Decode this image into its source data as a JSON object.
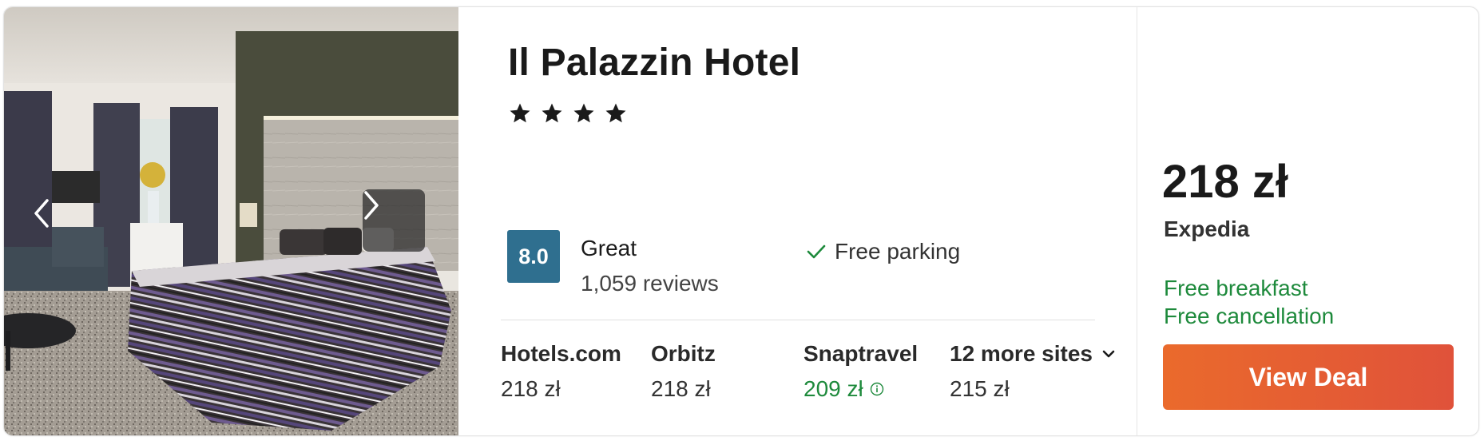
{
  "hotel": {
    "name": "Il Palazzin Hotel",
    "stars": 4
  },
  "gallery": {
    "prev_icon": "chevron-left-icon",
    "next_icon": "chevron-right-icon"
  },
  "rating": {
    "score": "8.0",
    "label": "Great",
    "reviews": "1,059 reviews",
    "badge_color": "#2f6f8f"
  },
  "amenities": [
    {
      "icon": "check-icon",
      "label": "Free parking"
    }
  ],
  "other_sites": [
    {
      "name": "Hotels.com",
      "price": "218 zł"
    },
    {
      "name": "Orbitz",
      "price": "218 zł"
    },
    {
      "name": "Snaptravel",
      "price": "209 zł",
      "info_icon": "info-icon"
    },
    {
      "name": "12 more sites",
      "price": "215 zł",
      "icon": "chevron-down-icon"
    }
  ],
  "best_deal": {
    "price": "218 zł",
    "provider": "Expedia",
    "perks": [
      "Free breakfast",
      "Free cancellation"
    ],
    "button_label": "View Deal"
  },
  "colors": {
    "deal_green": "#1e8a3c",
    "button_start": "#ea6a2c",
    "button_end": "#e0523a"
  }
}
